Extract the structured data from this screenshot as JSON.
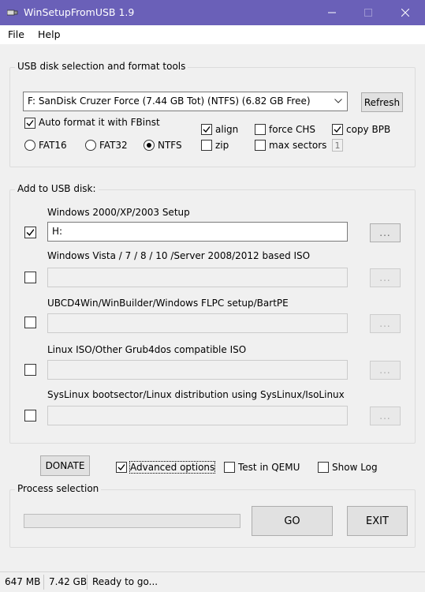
{
  "window": {
    "title": "WinSetupFromUSB 1.9",
    "titlebar_color": "#6a60b8"
  },
  "menu": [
    "File",
    "Help"
  ],
  "usb_section": {
    "label": "USB disk selection and format tools",
    "disk_value": "F: SanDisk Cruzer Force (7.44 GB Tot) (NTFS) (6.82 GB Free)",
    "refresh_label": "Refresh",
    "auto_format_label": "Auto format it with FBinst",
    "auto_format_checked": true,
    "fs_options": [
      "FAT16",
      "FAT32",
      "NTFS"
    ],
    "fs_selected": "NTFS",
    "align_label": "align",
    "align_checked": true,
    "zip_label": "zip",
    "zip_checked": false,
    "force_chs_label": "force CHS",
    "force_chs_checked": false,
    "max_sectors_label": "max sectors",
    "max_sectors_checked": false,
    "max_sectors_value": "1",
    "copy_bpb_label": "copy BPB",
    "copy_bpb_checked": true
  },
  "add_section": {
    "label": "Add to USB disk:",
    "browse_label": "...",
    "items": [
      {
        "label": "Windows 2000/XP/2003 Setup",
        "checked": true,
        "value": "H:"
      },
      {
        "label": "Windows Vista / 7 / 8 / 10 /Server 2008/2012 based ISO",
        "checked": false,
        "value": ""
      },
      {
        "label": "UBCD4Win/WinBuilder/Windows FLPC setup/BartPE",
        "checked": false,
        "value": ""
      },
      {
        "label": "Linux ISO/Other Grub4dos compatible ISO",
        "checked": false,
        "value": ""
      },
      {
        "label": "SysLinux bootsector/Linux distribution using SysLinux/IsoLinux",
        "checked": false,
        "value": ""
      }
    ]
  },
  "options": {
    "donate_label": "DONATE",
    "advanced_label": "Advanced options",
    "advanced_checked": true,
    "qemu_label": "Test in QEMU",
    "qemu_checked": false,
    "show_log_label": "Show Log",
    "show_log_checked": false
  },
  "process": {
    "label": "Process selection",
    "progress": 0,
    "go_label": "GO",
    "exit_label": "EXIT"
  },
  "status": {
    "memory": "647 MB",
    "disk_size": "7.42 GB",
    "message": "Ready to go..."
  }
}
